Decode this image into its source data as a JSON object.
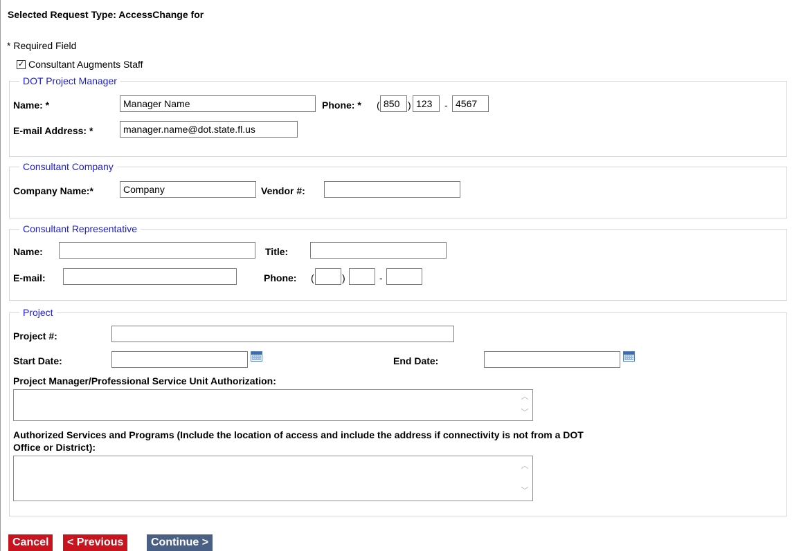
{
  "header": {
    "title": "Selected Request Type: AccessChange for",
    "required_note": "* Required Field"
  },
  "augments": {
    "label": "Consultant Augments Staff",
    "checked": true,
    "check_glyph": "✓"
  },
  "dot_pm": {
    "legend": "DOT Project Manager",
    "name_label": "Name: *",
    "name_value": "Manager Name",
    "phone_label": "Phone: *",
    "phone_area": "850",
    "phone_prefix": "123",
    "phone_line": "4567",
    "email_label": "E-mail Address: *",
    "email_value": "manager.name@dot.state.fl.us"
  },
  "company": {
    "legend": "Consultant Company",
    "name_label": "Company Name:*",
    "name_value": "Company",
    "vendor_label": "Vendor #:",
    "vendor_value": ""
  },
  "rep": {
    "legend": "Consultant Representative",
    "name_label": "Name:",
    "name_value": "",
    "title_label": "Title:",
    "title_value": "",
    "email_label": "E-mail:",
    "email_value": "",
    "phone_label": "Phone:",
    "phone_area": "",
    "phone_prefix": "",
    "phone_line": ""
  },
  "project": {
    "legend": "Project",
    "number_label": "Project #:",
    "number_value": "",
    "start_label": "Start Date:",
    "start_value": "",
    "end_label": "End Date:",
    "end_value": "",
    "auth_label": "Project Manager/Professional Service Unit Authorization:",
    "auth_value": "",
    "services_label_1": "Authorized Services and Programs (Include the location of access and include the address if connectivity is not from a DOT",
    "services_label_2": "Office or District):",
    "services_value": ""
  },
  "punct": {
    "open_paren": "(",
    "close_paren": ")",
    "dash": "-"
  },
  "buttons": {
    "cancel": "Cancel",
    "previous": "< Previous",
    "continue": "Continue >"
  },
  "icons": {
    "calendar": "calendar-icon",
    "scroll_up": "chevron-up-icon",
    "scroll_down": "chevron-down-icon"
  },
  "colors": {
    "legend": "#1b1bdc",
    "cancel_bg": "#c8141e",
    "continue_bg": "#4a5f84"
  }
}
